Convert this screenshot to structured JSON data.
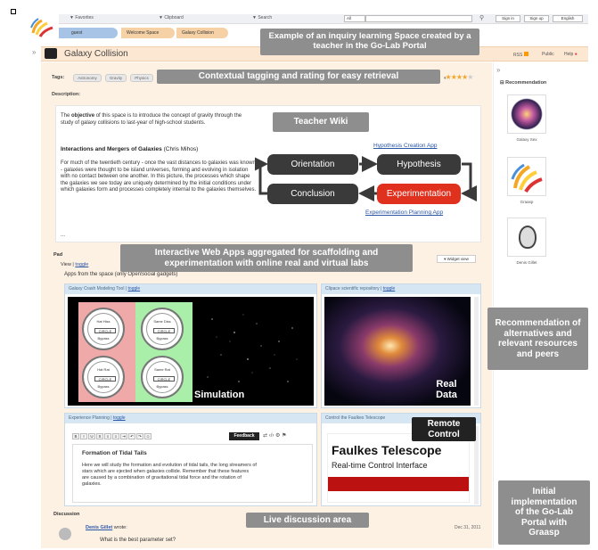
{
  "topbar": {
    "favorites": "▼ Favorites",
    "clipboard": "▼ Clipboard",
    "search": "▼ Search",
    "all": "All",
    "signin": "Sign in",
    "signup": "Sign up",
    "lang": "English"
  },
  "breadcrumb": {
    "user": "guest",
    "space": "Welcome Space",
    "page": "Galaxy Collision"
  },
  "title": "Galaxy Collision",
  "actions": {
    "rss": "RSS",
    "public": "Public",
    "help": "Help"
  },
  "tags": {
    "label": "Tags:",
    "items": [
      "Astronomy",
      "Gravity",
      "Physics"
    ]
  },
  "description_label": "Description:",
  "wiki": {
    "p1_pre": "The ",
    "p1_bold": "objective",
    "p1_post": " of this space is to introduce the concept of gravity through the study of galaxy collisions to last-year of high-school students.",
    "heading": "Interactions and Mergers of Galaxies",
    "heading_author": " (Chris Mihos)",
    "p2": "For much of the twentieth century - once the vast distances to galaxies was known - galaxies were thought to be island universes, forming and evolving in isolation with no contact between one another. In this picture, the processes which shape the galaxies we see today are uniquely determined by the initial conditions under which galaxies form and processes completely internal to the galaxies themselves.",
    "more": "..."
  },
  "flow": {
    "hyp_link": "Hypothesis Creation App",
    "orientation": "Orientation",
    "hypothesis": "Hypothesis",
    "conclusion": "Conclusion",
    "experimentation": "Experimentation",
    "exp_link": "Experimentation Planning App"
  },
  "pad": {
    "label": "Pad",
    "view": "View | ",
    "toggle": "toggle",
    "widget_view": "▾ Widget view",
    "apps_title": "Apps from the space (only OpenSocial gadgets)"
  },
  "gadgets": {
    "crash": "Galaxy Crash Modeling Tool | ",
    "toggle": "toggle",
    "repo": "Clipace scientific repository | ",
    "planning": "Experience Planning | ",
    "faulkes": "Control the Faulkes Telescope"
  },
  "dials": [
    {
      "name": "Hat Hiss",
      "sub": "Bypass"
    },
    {
      "name": "Same Diss",
      "sub": "Bypass"
    },
    {
      "name": "Hat Rat",
      "sub": "Bypass"
    },
    {
      "name": "Same Rat",
      "sub": "Bypass"
    }
  ],
  "dial_box": "CIRCLE",
  "editor": {
    "feedback": "Feedback",
    "heading": "Formation of Tidal Tails",
    "body": "Here we will study the formation and evolution of tidal tails, the long streamers of stars which are ejected when galaxies collide. Remember that these features are caused by a combination of gravitational tidal force and the rotation of galaxies."
  },
  "faulkes": {
    "title": "Faulkes Telescope",
    "subtitle": "Real-time Control Interface"
  },
  "discussion": {
    "label": "Discussion",
    "author": "Denis Gillet",
    "wrote": " wrote:",
    "date": "Dec 31, 2011",
    "text": "What is the best parameter set?"
  },
  "recommendation": {
    "title": "Recommendation",
    "items": [
      "Galaxy Sex",
      "Graasp",
      "Denis Gillet"
    ]
  },
  "callouts": {
    "c1": "Example of an inquiry learning Space created by a teacher in the Go-Lab Portal",
    "c2": "Contextual tagging and rating for easy retrieval",
    "c3": "Teacher Wiki",
    "c4": "Interactive Web Apps aggregated for scaffolding and experimentation with online real and virtual labs",
    "c5": "Simulation",
    "c6": "Real Data",
    "c7": "Remote Control",
    "c8": "Recommendation of alternatives and relevant resources and peers",
    "c9": "Initial implementation of the Go-Lab Portal with Graasp",
    "c10": "Live discussion area"
  },
  "colors": {
    "callout": "#8e8e8e",
    "titlebar": "#fce7d2",
    "accent_red": "#e0301e",
    "panel_header": "#d6e6f2"
  }
}
